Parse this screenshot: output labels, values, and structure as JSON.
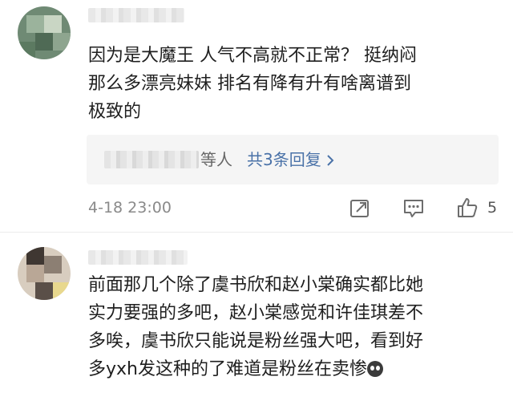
{
  "comments": [
    {
      "text": "因为是大魔王 人气不高就不正常？ 挺纳闷\n那么多漂亮妹妹 排名有降有升有啥离谱到\n极致的",
      "reply_summary": {
        "suffix": "等人",
        "link": "共3条回复",
        "link_icon": "chevron-right-icon"
      },
      "time": "4-18 23:00",
      "like_count": "5",
      "actions": [
        "share-icon",
        "comment-icon",
        "like-icon"
      ]
    },
    {
      "text": "前面那几个除了虞书欣和赵小棠确实都比她\n实力要强的多吧，赵小棠感觉和许佳琪差不\n多唉，虞书欣只能说是粉丝强大吧，看到好\n多yxh发这种的了难道是粉丝在卖惨",
      "trailing_emoji": "crying-emoji-icon"
    }
  ],
  "colors": {
    "link": "#4a72a8",
    "meta": "#8a8a8a",
    "reply_bg": "#f5f5f5"
  }
}
